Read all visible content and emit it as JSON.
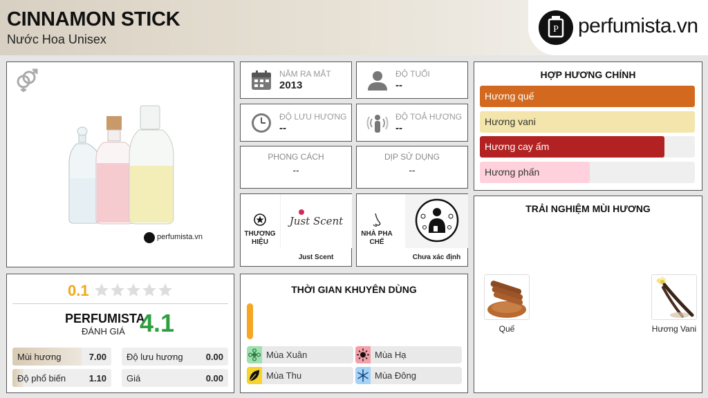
{
  "header": {
    "title": "CINNAMON STICK",
    "subtitle": "Nước Hoa Unisex",
    "logo_text": "perfumista.vn"
  },
  "product_image": {
    "gender_icon": "unisex-gender-icon",
    "watermark": "perfumista.vn"
  },
  "stats": {
    "launch_year": {
      "label": "NĂM RA MẮT",
      "value": "2013",
      "icon": "calendar-icon"
    },
    "age": {
      "label": "ĐỘ TUỔI",
      "value": "--",
      "icon": "person-icon"
    },
    "longevity": {
      "label": "ĐỘ LƯU HƯƠNG",
      "value": "--",
      "icon": "clock-icon"
    },
    "sillage": {
      "label": "ĐỘ TOẢ HƯƠNG",
      "value": "--",
      "icon": "sillage-icon"
    },
    "style": {
      "label": "PHONG CÁCH",
      "value": "--"
    },
    "occasion": {
      "label": "DỊP SỬ DỤNG",
      "value": "--"
    }
  },
  "brand": {
    "label_line1": "THƯƠNG",
    "label_line2": "HIỆU",
    "logo_text": "Just Scent",
    "name": "Just Scent"
  },
  "perfumer": {
    "label_line1": "NHÀ PHA",
    "label_line2": "CHẾ",
    "name": "Chưa xác định"
  },
  "accords": {
    "title": "HỢP HƯƠNG CHÍNH",
    "items": [
      {
        "label": "Hương quế",
        "percent": 100,
        "color": "#d2691e",
        "text_color": "#ffffff"
      },
      {
        "label": "Hương vani",
        "percent": 100,
        "color": "#f3e5ab",
        "text_color": "#333333"
      },
      {
        "label": "Hương cay ấm",
        "percent": 86,
        "color": "#b22222",
        "text_color": "#ffffff"
      },
      {
        "label": "Hương phấn",
        "percent": 51,
        "color": "#ffd1dc",
        "text_color": "#333333"
      }
    ]
  },
  "experience": {
    "title": "TRẢI NGHIỆM MÙI HƯƠNG",
    "notes": [
      {
        "label": "Quế",
        "icon": "cinnamon-icon"
      },
      {
        "label": "Hương Vani",
        "icon": "vanilla-icon"
      }
    ]
  },
  "rating": {
    "user_score": "0.1",
    "stars_filled": 0,
    "stars_total": 5,
    "brand_label": "PERFUMISTA",
    "rated_label": "ĐÁNH GIÁ",
    "score": "4.1",
    "bars": [
      {
        "label": "Mùi hương",
        "value": "7.00",
        "fraction": 0.7
      },
      {
        "label": "Độ lưu hương",
        "value": "0.00",
        "fraction": 0
      },
      {
        "label": "Độ phổ biến",
        "value": "1.10",
        "fraction": 0.11
      },
      {
        "label": "Giá",
        "value": "0.00",
        "fraction": 0
      }
    ]
  },
  "time": {
    "title": "THỜI GIAN KHUYÊN DÙNG",
    "day_night_level": 1.0,
    "accent": "#f5a623",
    "seasons": [
      {
        "label": "Mùa Xuân",
        "color": "#9fe0b0",
        "icon": "spring-flower-icon"
      },
      {
        "label": "Mùa Hạ",
        "color": "#f4a0a8",
        "icon": "sun-icon"
      },
      {
        "label": "Mùa Thu",
        "color": "#f6d32d",
        "icon": "leaf-icon"
      },
      {
        "label": "Mùa Đông",
        "color": "#a6d2f5",
        "icon": "snowflake-icon"
      }
    ]
  },
  "colors": {
    "score_green": "#2e9e3e",
    "user_score_orange": "#f0a81a",
    "rating_bar_fill": "#d9cbb4"
  }
}
